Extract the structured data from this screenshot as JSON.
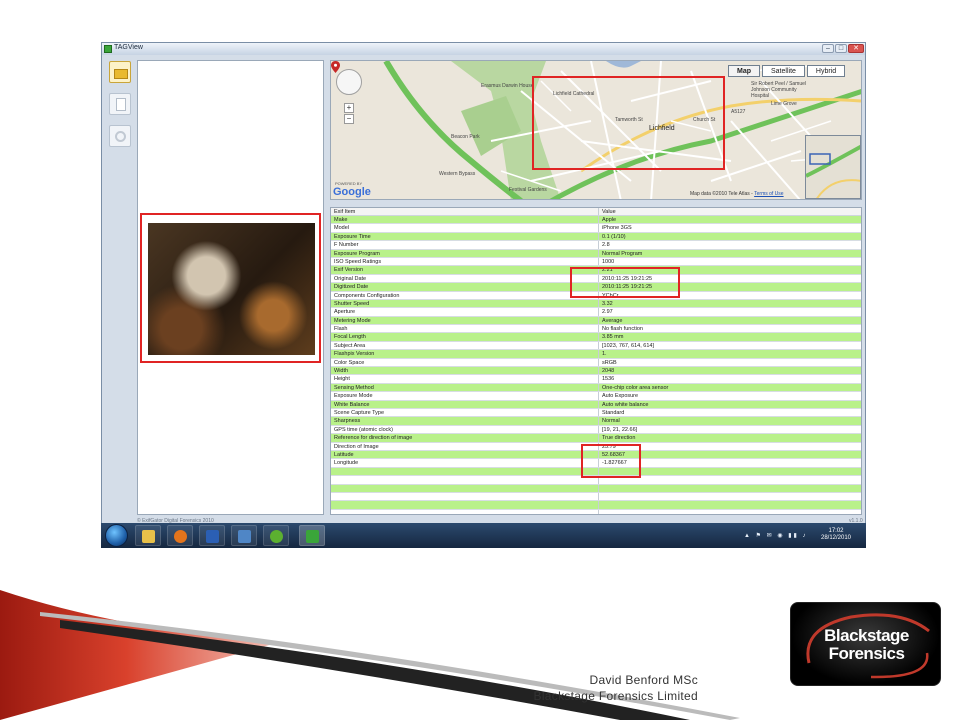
{
  "window": {
    "title": "TAGView",
    "min_label": "–",
    "max_label": "□",
    "close_label": "✕"
  },
  "map": {
    "tabs": [
      {
        "label": "Map",
        "active": true
      },
      {
        "label": "Satellite",
        "active": false
      },
      {
        "label": "Hybrid",
        "active": false
      }
    ],
    "zoom_in": "+",
    "zoom_out": "−",
    "labels": {
      "erasmus": "Erasmus Darwin House",
      "cathedral": "Lichfield Cathedral",
      "beacon": "Beacon Park",
      "lichfield": "Lichfield",
      "church": "Church St",
      "hospital": "Sir Robert Peel / Samuel Johnson Community Hospital",
      "lime": "Lime Grove",
      "western": "Western Bypass",
      "festival": "Festival Gardens",
      "tamworth": "Tamworth St",
      "a5127": "A5127"
    },
    "powered_by": "POWERED BY",
    "google": "Google",
    "copyright": "Map data ©2010 Tele Atlas -",
    "terms": "Terms of Use"
  },
  "exif": {
    "headers": {
      "item": "Exif Item",
      "value": "Value"
    },
    "rows": [
      {
        "item": "Make",
        "value": "Apple"
      },
      {
        "item": "Model",
        "value": "iPhone 3GS"
      },
      {
        "item": "Exposure Time",
        "value": "0.1 (1/10)"
      },
      {
        "item": "F Number",
        "value": "2.8"
      },
      {
        "item": "Exposure Program",
        "value": "Normal Program"
      },
      {
        "item": "ISO Speed Ratings",
        "value": "1000"
      },
      {
        "item": "Exif Version",
        "value": "2.21"
      },
      {
        "item": "Original Date",
        "value": "2010:11:25 19:21:25"
      },
      {
        "item": "Digitized Date",
        "value": "2010:11:25 19:21:25"
      },
      {
        "item": "Components Configuration",
        "value": "YCbCr"
      },
      {
        "item": "Shutter Speed",
        "value": "3.32"
      },
      {
        "item": "Aperture",
        "value": "2.97"
      },
      {
        "item": "Metering Mode",
        "value": "Average"
      },
      {
        "item": "Flash",
        "value": "No flash function"
      },
      {
        "item": "Focal Length",
        "value": "3.85 mm"
      },
      {
        "item": "Subject Area",
        "value": "[1023, 767, 614, 614]"
      },
      {
        "item": "Flashpix Version",
        "value": "1."
      },
      {
        "item": "Color Space",
        "value": "sRGB"
      },
      {
        "item": "Width",
        "value": "2048"
      },
      {
        "item": "Height",
        "value": "1536"
      },
      {
        "item": "Sensing Method",
        "value": "One-chip color area sensor"
      },
      {
        "item": "Exposure Mode",
        "value": "Auto Exposure"
      },
      {
        "item": "White Balance",
        "value": "Auto white balance"
      },
      {
        "item": "Scene Capture Type",
        "value": "Standard"
      },
      {
        "item": "Sharpness",
        "value": "Normal"
      },
      {
        "item": "GPS time (atomic clock)",
        "value": "[19, 21, 22.66]"
      },
      {
        "item": "Reference for direction of image",
        "value": "True direction"
      },
      {
        "item": "Direction of Image",
        "value": "25.79"
      },
      {
        "item": "Latitude",
        "value": "52.68367"
      },
      {
        "item": "Longitude",
        "value": "-1.827667"
      },
      {
        "item": "",
        "value": ""
      },
      {
        "item": "",
        "value": ""
      },
      {
        "item": "",
        "value": ""
      },
      {
        "item": "",
        "value": ""
      },
      {
        "item": "",
        "value": ""
      },
      {
        "item": "",
        "value": ""
      }
    ]
  },
  "footer": {
    "left": "© ExifGator Digital Forensics 2010",
    "right": "v1.1.0"
  },
  "taskbar": {
    "apps": [
      "explorer",
      "firefox",
      "word",
      "tool",
      "spotify",
      "tagview"
    ],
    "tray": "▲ ⚑ ✉ ◉ ▮▮ ♪",
    "time": "17:02",
    "date": "28/12/2010"
  },
  "slide": {
    "author_name": "David Benford MSc",
    "author_company": "Blackstage Forensics Limited",
    "logo_line1": "Blackstage",
    "logo_line2": "Forensics"
  },
  "colors": {
    "highlight": "#e02424",
    "row_green": "#b9f18a",
    "accent": "#c0392b"
  }
}
